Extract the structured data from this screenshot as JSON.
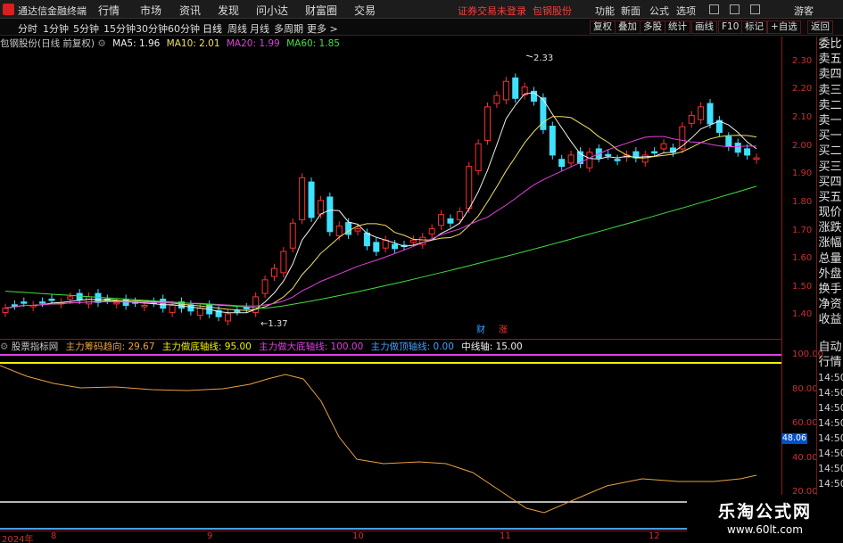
{
  "app": {
    "title": "通达信金融终端"
  },
  "menu": [
    "行情",
    "市场",
    "资讯",
    "发现",
    "问小达",
    "财富圈",
    "交易"
  ],
  "login_notice": "证券交易未登录",
  "stock_name_top": "包钢股份",
  "right_menu": [
    "功能",
    "新面",
    "公式",
    "选项"
  ],
  "guest": "游客",
  "periods": [
    "分时",
    "1分钟",
    "5分钟",
    "15分钟",
    "30分钟",
    "60分钟",
    "日线",
    "周线",
    "月线",
    "多周期",
    "更多 >"
  ],
  "active_period": "日线",
  "tools": [
    "复权",
    "叠加",
    "多股",
    "统计",
    "画线",
    "F10",
    "标记",
    "+自选",
    "返回"
  ],
  "price_panel": {
    "stock": "包钢股份(日线 前复权)",
    "ma": [
      {
        "label": "MA5: 1.96",
        "color": "#f0f0f0"
      },
      {
        "label": "MA10: 2.01",
        "color": "#f0e060"
      },
      {
        "label": "MA20: 1.99",
        "color": "#e040e0"
      },
      {
        "label": "MA60: 1.85",
        "color": "#40e040"
      }
    ],
    "yaxis": [
      "2.30",
      "2.20",
      "2.10",
      "2.00",
      "1.90",
      "1.80",
      "1.70",
      "1.60",
      "1.50",
      "1.40"
    ],
    "high_label": "2.33",
    "low_label": "1.37",
    "marker_cai": "财",
    "marker_zhang": "涨"
  },
  "quote_sidebar": [
    "委比",
    "卖五",
    "卖四",
    "卖三",
    "卖二",
    "卖一",
    "买一",
    "买二",
    "买三",
    "买四",
    "买五",
    "现价",
    "涨跌",
    "涨幅",
    "总量",
    "外盘",
    "换手",
    "净资",
    "收益"
  ],
  "indicator_panel": {
    "name": "股票指标网",
    "items": [
      {
        "label": "主力筹码趋向: 29.67",
        "color": "#e8a040"
      },
      {
        "label": "主力做底轴线: 95.00",
        "color": "#f0f000"
      },
      {
        "label": "主力做大底轴线: 100.00",
        "color": "#e040e0"
      },
      {
        "label": "主力做顶轴线: 0.00",
        "color": "#40a0ff"
      },
      {
        "label": "中线轴: 15.00",
        "color": "#f0f0f0"
      }
    ],
    "yaxis": [
      "100.00",
      "80.00",
      "60.00",
      "40.00",
      "20.00"
    ],
    "current": "48.06"
  },
  "left_sidebar": [
    "自动",
    "行情"
  ],
  "times": [
    "14:50",
    "14:50",
    "14:50",
    "14:50",
    "14:50",
    "14:50",
    "14:50",
    "14:50",
    "14:50",
    "14:50"
  ],
  "xaxis": [
    {
      "text": "2024年",
      "pos": 0
    },
    {
      "text": "8",
      "pos": 1
    },
    {
      "text": "9",
      "pos": 2
    },
    {
      "text": "10",
      "pos": 3
    },
    {
      "text": "11",
      "pos": 4
    },
    {
      "text": "12",
      "pos": 5
    }
  ],
  "watermark": {
    "title": "乐淘公式网",
    "url": "www.60lt.com"
  },
  "chart_data": {
    "type": "candlestick",
    "ylim": [
      1.37,
      2.33
    ],
    "candles": [
      1.42,
      1.43,
      1.44,
      1.43,
      1.44,
      1.45,
      1.44,
      1.46,
      1.45,
      1.46,
      1.44,
      1.45,
      1.44,
      1.43,
      1.44,
      1.43,
      1.44,
      1.42,
      1.43,
      1.42,
      1.41,
      1.42,
      1.4,
      1.39,
      1.4,
      1.41,
      1.42,
      1.46,
      1.52,
      1.56,
      1.62,
      1.72,
      1.88,
      1.74,
      1.8,
      1.69,
      1.71,
      1.68,
      1.7,
      1.64,
      1.62,
      1.66,
      1.63,
      1.64,
      1.66,
      1.67,
      1.7,
      1.75,
      1.72,
      1.76,
      1.92,
      2.0,
      2.13,
      2.17,
      2.22,
      2.16,
      2.2,
      2.15,
      2.05,
      1.96,
      1.92,
      1.96,
      1.93,
      1.97,
      1.95,
      1.96,
      1.94,
      1.96,
      1.95,
      1.96,
      1.97,
      2.0,
      1.97,
      2.06,
      2.1,
      2.13,
      2.07,
      2.04,
      1.99,
      1.97,
      1.96,
      1.95
    ]
  }
}
